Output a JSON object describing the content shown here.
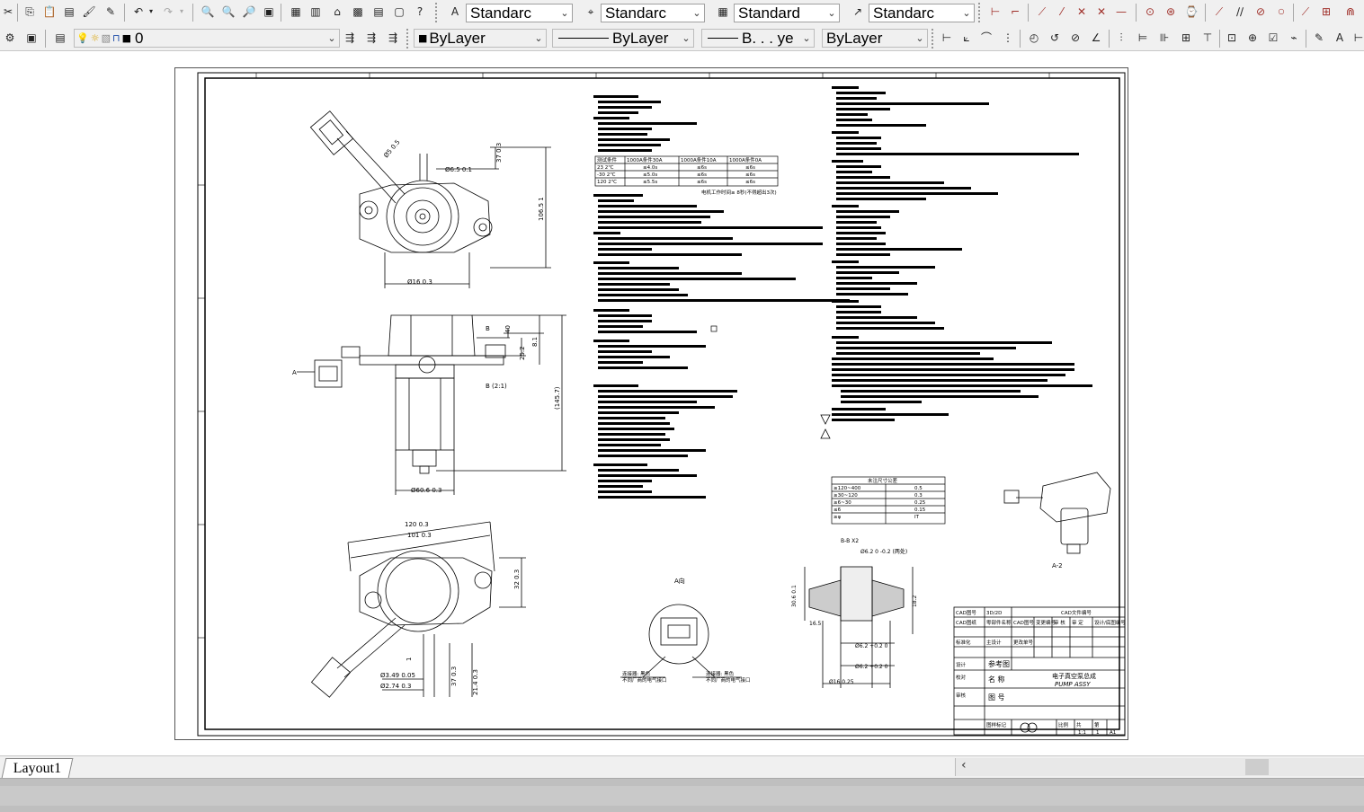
{
  "toolbar": {
    "text_style": "Standarc",
    "dim_style": "Standarc",
    "table_style": "Standard",
    "multileader_style": "Standarc"
  },
  "layers": {
    "current_layer": "0",
    "color": "ByLayer",
    "linetype": "ByLayer",
    "lineweight": "B. . . ye",
    "plot_style": "ByLayer"
  },
  "drawing": {
    "spec_table_headers": [
      "测试条件",
      "1000A条件30A",
      "1000A条件10A",
      "1000A条件0A"
    ],
    "spec_table_rows": [
      [
        "23  2℃",
        "≤4.0s",
        "≤6s",
        "≤6s"
      ],
      [
        "-30  2℃",
        "≤5.0s",
        "≤6s",
        "≤6s"
      ],
      [
        "120  2℃",
        "≤5.5s",
        "≤6s",
        "≤6s"
      ]
    ],
    "spec_table_note": "电机工作时间≥ 8秒(不得超出3次)",
    "tol_table_title": "未注尺寸公差",
    "tol_table_rows": [
      [
        "≥120~400",
        "0.5"
      ],
      [
        "≥30~120",
        "0.3"
      ],
      [
        "≥6~30",
        "0.25"
      ],
      [
        "≤6",
        "0.15"
      ],
      [
        "≥φ",
        "IT"
      ]
    ],
    "view_a_label": "A向",
    "iso_view_label": "A-2",
    "section_label": "B-B X2",
    "dims": {
      "d_16": "Ø16  0.3",
      "d_95": "Ø6.5  0.1",
      "d_37": "37 0.3",
      "d_1065": "106.5 1",
      "d_80": "Ø5  0.5",
      "d_60": "Ø60.6  0.3",
      "d_120": "120  0.3",
      "d_101": "101  0.3",
      "d_32": "32  0.3",
      "d_37b": "37  0.3",
      "d_3249": "Ø3.49  0.05",
      "d_4274": "Ø2.74  0.3",
      "d_252": "25.2",
      "d_145": "(145.7)",
      "d_40": "40",
      "d_b": "B",
      "d_a": "A",
      "d_81": "8.1",
      "d_314": "21.4  0.3",
      "d_1": "1",
      "d_b2": "B (2:1)",
      "d_62a": "Ø6.2  0 -0.2 (两处)",
      "d_62b": "Ø6.2  +0.2 0",
      "d_62c": "Ø6.2  +0.2 0",
      "d_16b": "Ø16  0.25",
      "d_314b": "30.6  0.1",
      "d_182": "18.2",
      "d_16c": "16.5"
    },
    "callout_left": "连接器: 黑色",
    "callout_left2": "不同厂商的电气接口",
    "callout_right": "连接器: 黑色",
    "callout_right2": "不同厂商的电气接口"
  },
  "title_block": {
    "company": "CAD文件编号",
    "row1": [
      "CAD图号",
      "3D/2D",
      "CAD文件编号"
    ],
    "row2": [
      "CAD图纸",
      "零部件名称",
      "CAD图号",
      "变更编号",
      "审 核",
      "审 定",
      "设计/底图编号"
    ],
    "row3": [
      "标准化",
      "主设计",
      "更改单号",
      "签名",
      "日期",
      "标准化",
      "批准",
      "N"
    ],
    "row4": [
      "设计",
      "校对",
      "审核",
      "工艺",
      "标准化",
      "批准"
    ],
    "ref_label": "参考图",
    "name_label": "名 称",
    "name_cn": "电子真空泵总成",
    "name_en": "PUMP ASSY",
    "drawing_label": "图 号",
    "bottom": [
      "图样标记",
      "重量",
      "比例",
      "共",
      "第"
    ],
    "bottom_vals": [
      "",
      "",
      "1:1",
      "1",
      "A1"
    ]
  },
  "layout_tab": "Layout1"
}
